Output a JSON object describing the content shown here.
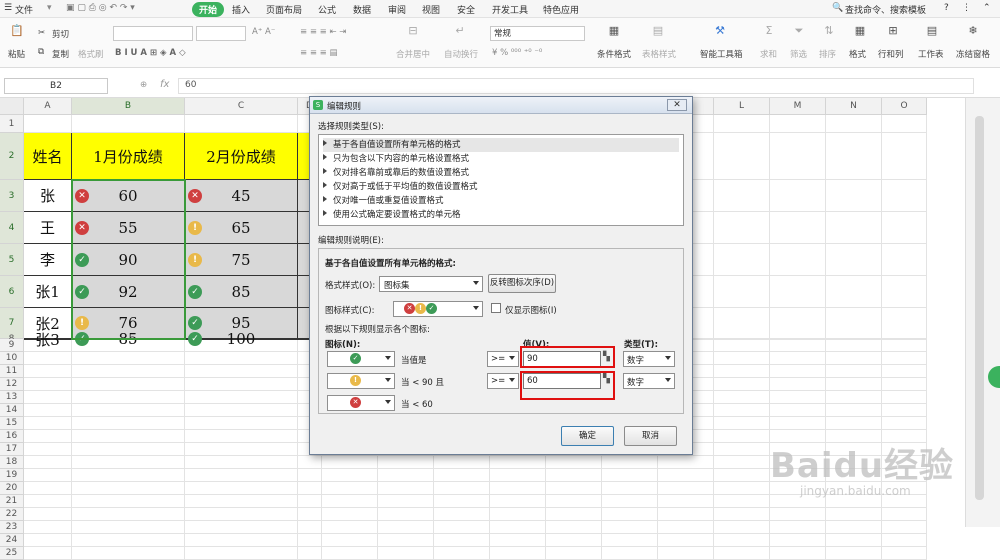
{
  "menubar": {
    "file": "文件",
    "tabs": [
      "开始",
      "插入",
      "页面布局",
      "公式",
      "数据",
      "审阅",
      "视图",
      "安全",
      "开发工具",
      "特色应用"
    ],
    "search": "查找命令、搜索模板"
  },
  "ribbon": {
    "paste": "粘贴",
    "cut": "剪切",
    "copy": "复制",
    "format_painter": "格式刷",
    "merge_center": "合并居中",
    "auto_wrap": "自动换行",
    "number_format": "常规",
    "conditional_format": "条件格式",
    "table_style": "表格样式",
    "smart_toolbox": "智能工具箱",
    "sum": "求和",
    "filter": "筛选",
    "sort": "排序",
    "format": "格式",
    "rows_cols": "行和列",
    "worksheet": "工作表",
    "freeze": "冻结窗格"
  },
  "formula_bar": {
    "cell_ref": "B2",
    "fx": "fx",
    "value": "60"
  },
  "sheet": {
    "columns": [
      "A",
      "B",
      "C",
      "D",
      "E",
      "F",
      "G",
      "H",
      "I",
      "J",
      "K",
      "L",
      "M",
      "N",
      "O"
    ],
    "rows": [
      "1",
      "2",
      "3",
      "4",
      "5",
      "6",
      "7",
      "8",
      "9",
      "10",
      "11",
      "12",
      "13",
      "14",
      "15",
      "16",
      "17",
      "18",
      "19",
      "20",
      "21",
      "22",
      "23",
      "24",
      "25"
    ],
    "header": [
      "姓名",
      "1月份成绩",
      "2月份成绩"
    ],
    "data": [
      {
        "name": "张",
        "m1": "60",
        "m1_icon": "red",
        "m2": "45",
        "m2_icon": "red"
      },
      {
        "name": "王",
        "m1": "55",
        "m1_icon": "red",
        "m2": "65",
        "m2_icon": "yellow"
      },
      {
        "name": "李",
        "m1": "90",
        "m1_icon": "green",
        "m2": "75",
        "m2_icon": "yellow"
      },
      {
        "name": "张1",
        "m1": "92",
        "m1_icon": "green",
        "m2": "85",
        "m2_icon": "green"
      },
      {
        "name": "张2",
        "m1": "76",
        "m1_icon": "yellow",
        "m2": "95",
        "m2_icon": "green"
      },
      {
        "name": "张3",
        "m1": "85",
        "m1_icon": "green",
        "m2": "100",
        "m2_icon": "green"
      }
    ]
  },
  "dialog": {
    "title": "编辑规则",
    "select_rule_type": "选择规则类型(S):",
    "rule_types": [
      "基于各自值设置所有单元格的格式",
      "只为包含以下内容的单元格设置格式",
      "仅对排名靠前或靠后的数值设置格式",
      "仅对高于或低于平均值的数值设置格式",
      "仅对唯一值或重复值设置格式",
      "使用公式确定要设置格式的单元格"
    ],
    "edit_rule_desc": "编辑规则说明(E):",
    "desc_heading": "基于各自值设置所有单元格的格式:",
    "format_style_label": "格式样式(O):",
    "format_style_value": "图标集",
    "reverse_btn": "反转图标次序(D)",
    "icon_style_label": "图标样式(C):",
    "show_icon_only": "仅显示图标(I)",
    "rule_caption": "根据以下规则显示各个图标:",
    "icon_col": "图标(N):",
    "value_col": "值(V):",
    "type_col": "类型(T):",
    "rules": [
      {
        "icon": "green",
        "cond": "当值是",
        "op": ">=",
        "value": "90",
        "type": "数字"
      },
      {
        "icon": "yellow",
        "cond": "当 < 90 且",
        "op": ">=",
        "value": "60",
        "type": "数字"
      },
      {
        "icon": "red",
        "cond": "当 < 60"
      }
    ],
    "ok": "确定",
    "cancel": "取消"
  },
  "watermark": {
    "brand": "Baidu经验",
    "url": "jingyan.baidu.com"
  },
  "colors": {
    "accent": "#3bb25e",
    "header_fill": "#ffff00",
    "icon_red": "#cf3f3f",
    "icon_yellow": "#e9b949",
    "icon_green": "#3d9b57",
    "highlight_box": "#e01010"
  }
}
